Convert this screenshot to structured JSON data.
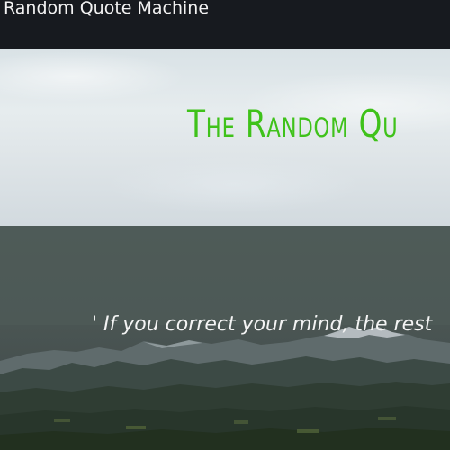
{
  "navbar": {
    "brand": "Random Quote Machine"
  },
  "hero": {
    "title": "The Random Qu"
  },
  "quote": {
    "text": "' If you correct your mind, the rest"
  },
  "colors": {
    "navbar_bg": "#171a1f",
    "title_green": "#3fc21a",
    "quote_text": "#f4f4f4"
  }
}
